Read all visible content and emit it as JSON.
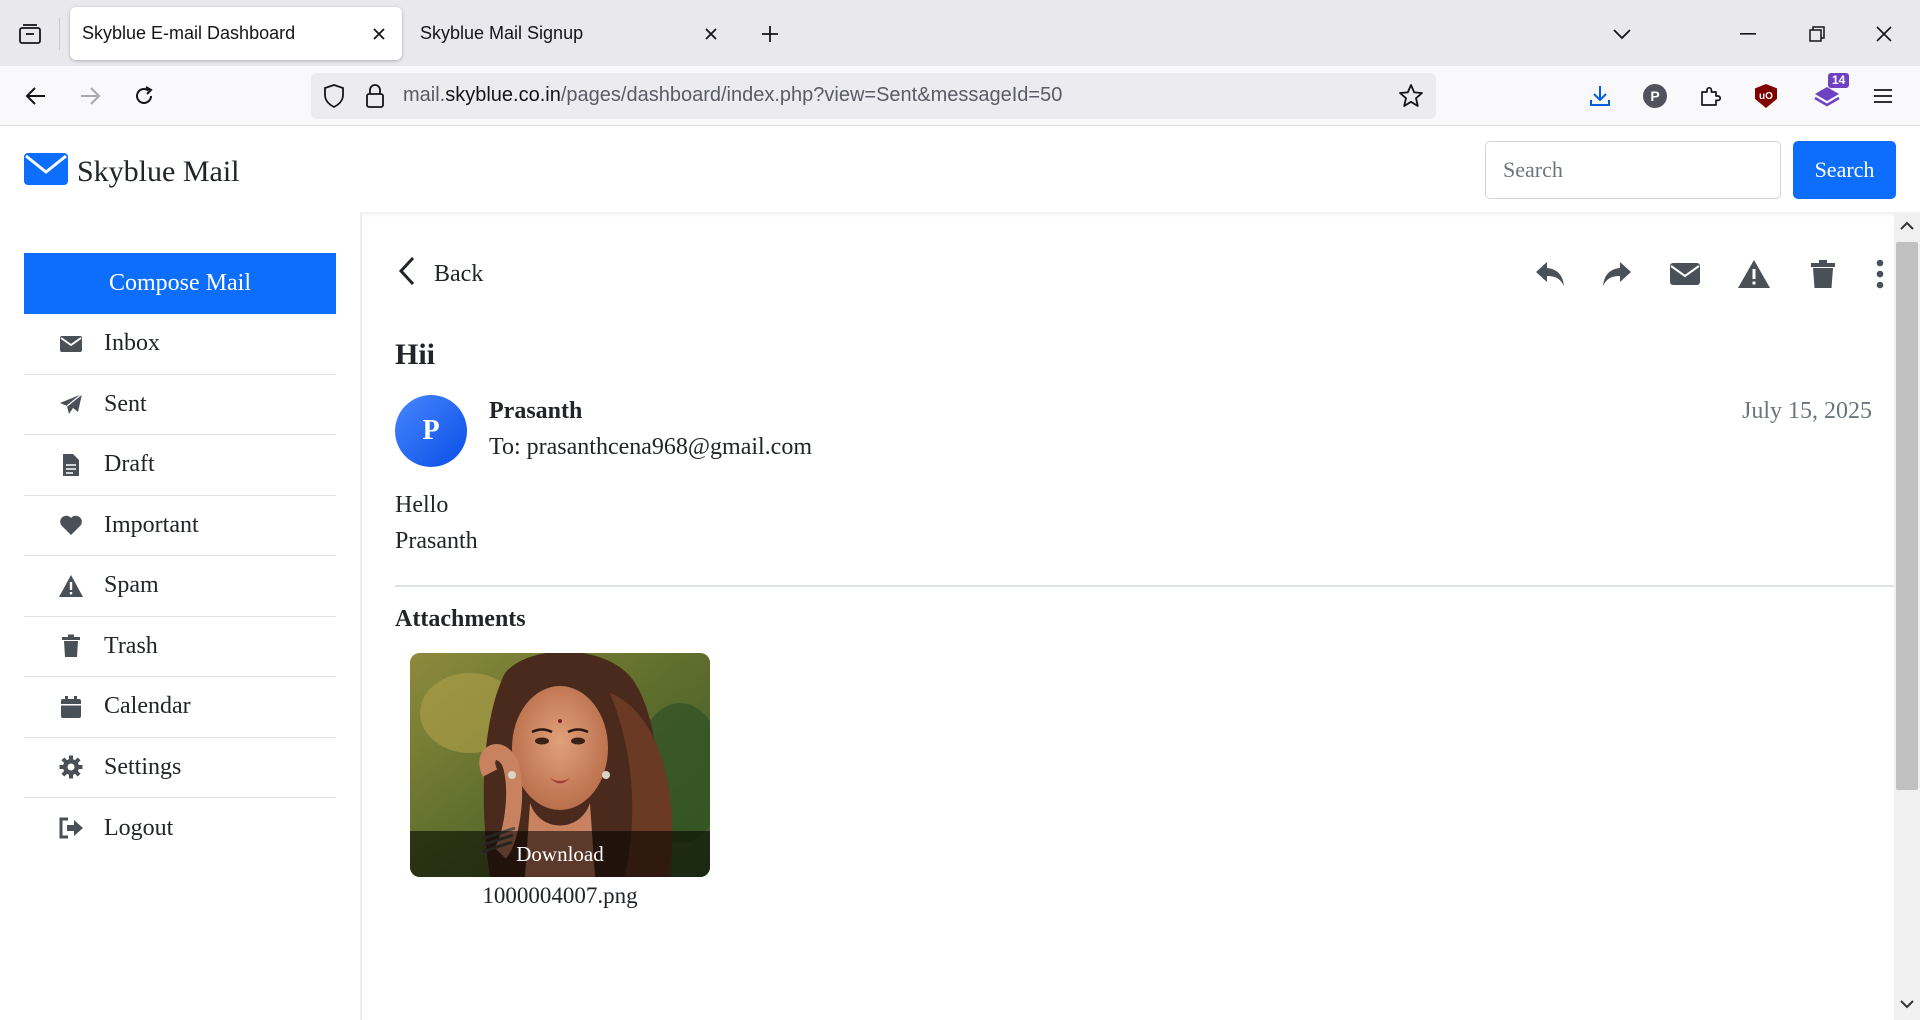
{
  "browser": {
    "tabs": [
      {
        "title": "Skyblue E-mail Dashboard",
        "active": true
      },
      {
        "title": "Skyblue Mail Signup",
        "active": false
      }
    ],
    "url": {
      "prefix": "mail.",
      "domain": "skyblue.co.in",
      "path": "/pages/dashboard/index.php?view=Sent&messageId=50"
    },
    "profile_initial": "P",
    "ublock_label": "uO",
    "extension_badge": "14"
  },
  "app": {
    "brand_name": "Skyblue Mail",
    "search_placeholder": "Search",
    "search_button": "Search",
    "accent_color": "#0d6efd"
  },
  "sidebar": {
    "compose_label": "Compose Mail",
    "items": [
      {
        "label": "Inbox",
        "icon": "envelope-icon"
      },
      {
        "label": "Sent",
        "icon": "paper-plane-icon"
      },
      {
        "label": "Draft",
        "icon": "file-icon"
      },
      {
        "label": "Important",
        "icon": "heart-icon"
      },
      {
        "label": "Spam",
        "icon": "warning-icon"
      },
      {
        "label": "Trash",
        "icon": "trash-icon"
      },
      {
        "label": "Calendar",
        "icon": "calendar-icon"
      },
      {
        "label": "Settings",
        "icon": "gear-icon"
      },
      {
        "label": "Logout",
        "icon": "logout-icon"
      }
    ]
  },
  "message": {
    "back_label": "Back",
    "subject": "Hii",
    "sender_initial": "P",
    "sender_name": "Prasanth",
    "to_label": "To:",
    "recipient": "prasanthcena968@gmail.com",
    "date": "July 15, 2025",
    "body_lines": [
      "Hello",
      "Prasanth"
    ],
    "actions": [
      "reply-icon",
      "forward-icon",
      "envelope-icon",
      "warning-icon",
      "trash-icon",
      "more-vertical-icon"
    ]
  },
  "attachments": {
    "title": "Attachments",
    "items": [
      {
        "filename": "1000004007.png",
        "download_label": "Download"
      }
    ]
  }
}
